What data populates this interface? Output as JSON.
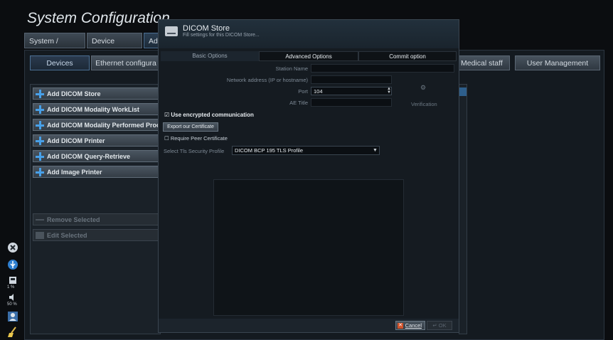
{
  "app_title": "System Configuration",
  "top_tabs": [
    "System / Display",
    "Device Settings",
    "Adm"
  ],
  "sub_tabs": [
    "Devices",
    "Ethernet configura",
    "Medical staff",
    "User Management"
  ],
  "device_actions": [
    "Add DICOM Store",
    "Add DICOM Modality WorkList",
    "Add DICOM Modality Performed Procedu",
    "Add DICOM Printer",
    "Add DICOM Query-Retrieve",
    "Add Image Printer"
  ],
  "remove_selected": "Remove Selected",
  "edit_selected": "Edit Selected",
  "side_status": {
    "percent_1": "1 %",
    "percent_2": "50 %"
  },
  "dialog": {
    "title": "DICOM Store",
    "subtitle": "Fill settings for this DICOM Store...",
    "tabs": [
      "Basic Options",
      "Advanced Options",
      "Commit option"
    ],
    "station_name_label": "Station Name",
    "station_name_value": "",
    "network_address_label": "Network address (IP or hostname)",
    "network_address_value": "",
    "port_label": "Port",
    "port_value": "104",
    "ae_title_label": "AE Title",
    "ae_title_value": "",
    "verification_label": "Verification",
    "use_encrypted_label": "Use encrypted communication",
    "use_encrypted_checked": "☑",
    "export_certificate_label": "Export our Certificate",
    "require_peer_label": "Require Peer Certificate",
    "require_peer_checked": "☐",
    "tls_profile_label": "Select Tls Security Profile",
    "tls_profile_value": "DICOM BCP 195 TLS Profile",
    "cancel_label": "Cancel",
    "ok_label": "OK"
  }
}
